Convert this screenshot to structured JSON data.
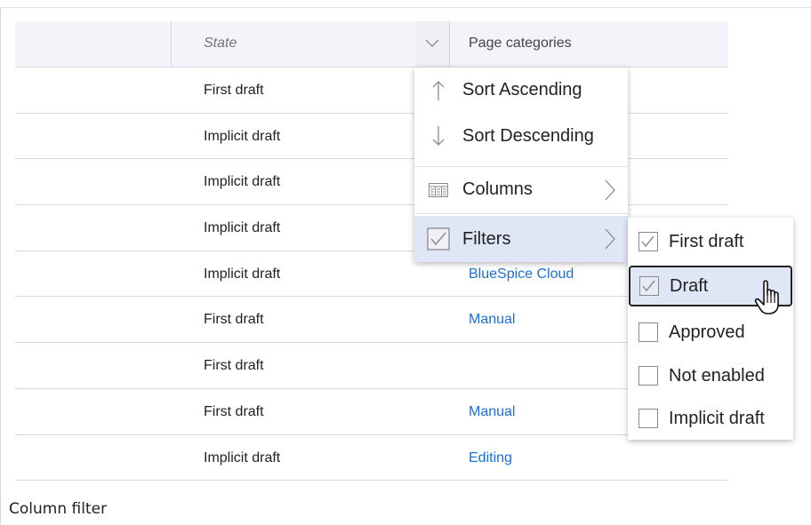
{
  "grid": {
    "columns": {
      "state": "State",
      "page_categories": "Page categories"
    },
    "rows": [
      {
        "state": "First draft",
        "category": ""
      },
      {
        "state": "Implicit draft",
        "category": ""
      },
      {
        "state": "Implicit draft",
        "category": ""
      },
      {
        "state": "Implicit draft",
        "category": ""
      },
      {
        "state": "Implicit draft",
        "category": "BlueSpice Cloud"
      },
      {
        "state": "First draft",
        "category": "Manual"
      },
      {
        "state": "First draft",
        "category": ""
      },
      {
        "state": "First draft",
        "category": "Manual"
      },
      {
        "state": "Implicit draft",
        "category": "Editing"
      }
    ]
  },
  "column_menu": {
    "items": [
      {
        "label": "Sort Ascending",
        "icon": "arrow-up-icon"
      },
      {
        "label": "Sort Descending",
        "icon": "arrow-down-icon"
      },
      {
        "label": "Columns",
        "icon": "columns-icon"
      },
      {
        "label": "Filters",
        "icon": "checkbox-checked-icon"
      }
    ]
  },
  "filters_submenu": {
    "options": [
      {
        "label": "First draft",
        "checked": true
      },
      {
        "label": "Draft",
        "checked": true
      },
      {
        "label": "Approved",
        "checked": false
      },
      {
        "label": "Not enabled",
        "checked": false
      },
      {
        "label": "Implicit draft",
        "checked": false
      }
    ]
  },
  "caption": "Column filter",
  "colors": {
    "header_bg": "#f2f4f9",
    "link": "#1a6fd6",
    "active_item_bg": "#dfe6f5"
  }
}
